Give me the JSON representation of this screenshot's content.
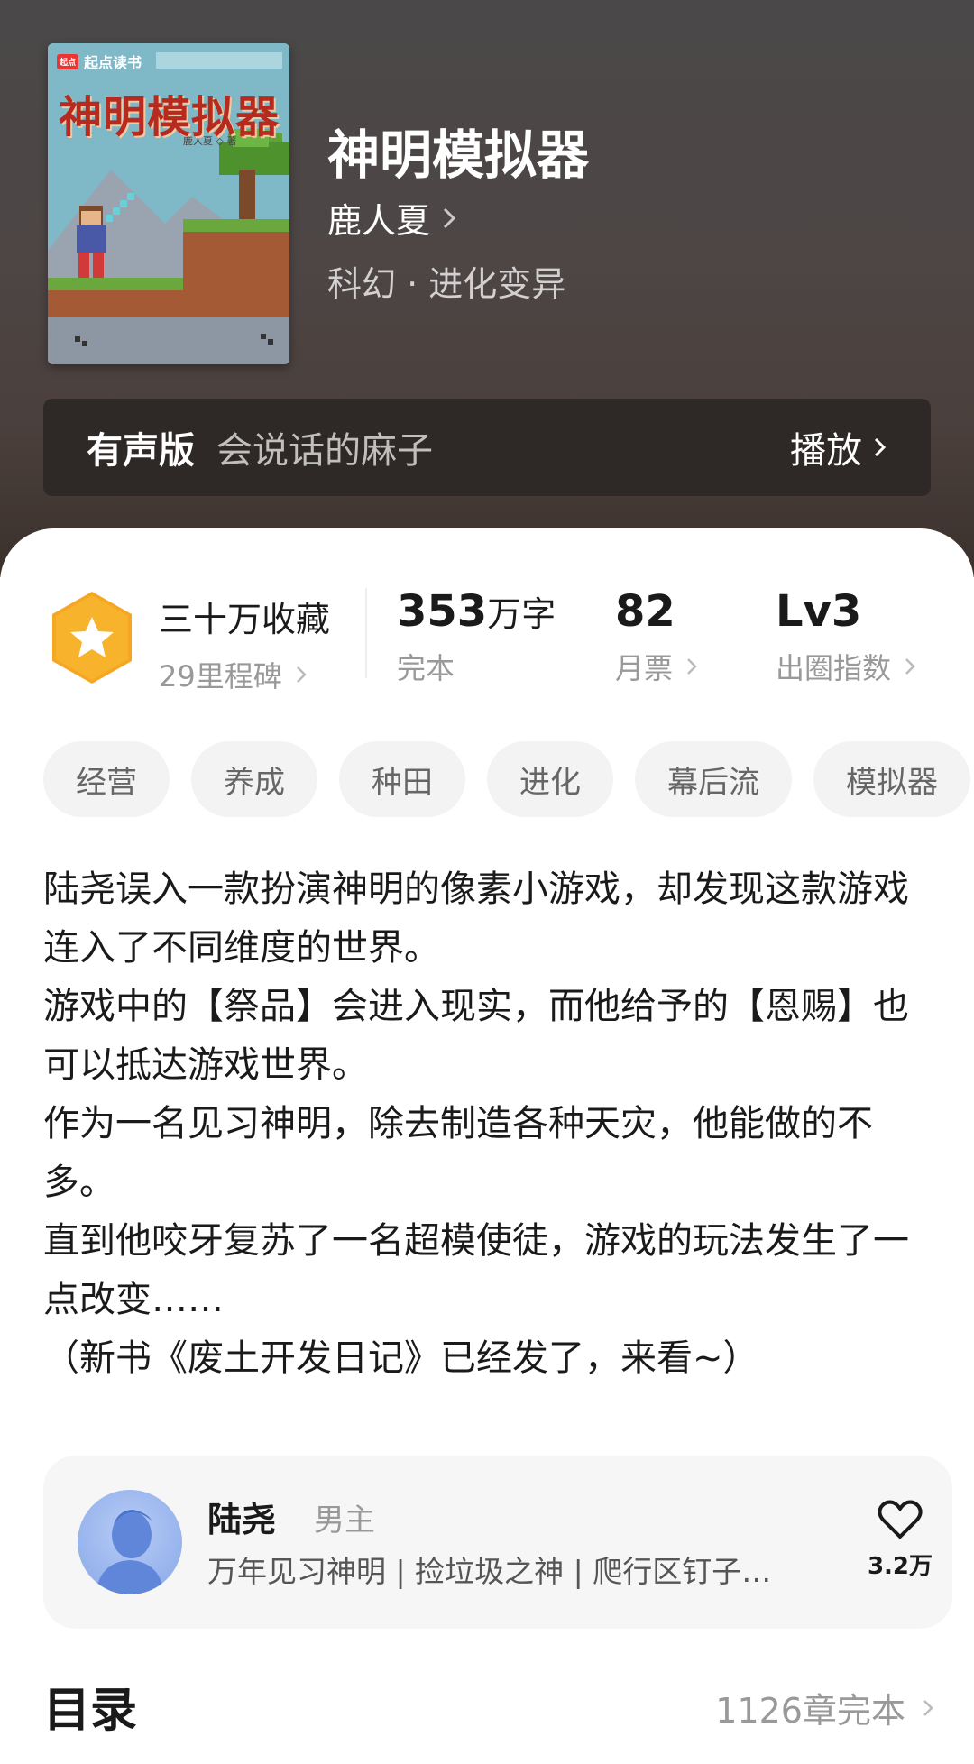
{
  "book": {
    "cover_brand": "起点读书",
    "cover_brand_logo": "起点",
    "cover_title": "神明模拟器",
    "cover_author": "鹿人夏 ◇ 著",
    "title": "神明模拟器",
    "author": "鹿人夏",
    "genre": "科幻 · 进化变异"
  },
  "audio": {
    "label": "有声版",
    "narrator": "会说话的麻子",
    "play_label": "播放"
  },
  "stats": {
    "favorites": "三十万收藏",
    "milestones": "29里程碑",
    "word_count": "353",
    "word_unit": "万字",
    "status": "完本",
    "monthly_tickets": "82",
    "monthly_tickets_label": "月票",
    "level": "Lv3",
    "level_label": "出圈指数"
  },
  "tags": [
    "经营",
    "养成",
    "种田",
    "进化",
    "幕后流",
    "模拟器"
  ],
  "synopsis": [
    "陆尧误入一款扮演神明的像素小游戏，却发现这款游戏连入了不同维度的世界。",
    "游戏中的【祭品】会进入现实，而他给予的【恩赐】也可以抵达游戏世界。",
    "作为一名见习神明，除去制造各种天灾，他能做的不多。",
    "直到他咬牙复苏了一名超模使徒，游戏的玩法发生了一点改变……",
    "（新书《废土开发日记》已经发了，来看~）"
  ],
  "character": {
    "name": "陆尧",
    "role": "男主",
    "description": "万年见习神明 | 捡垃圾之神 | 爬行区钉子…",
    "likes": "3.2万"
  },
  "toc": {
    "title": "目录",
    "info": "1126章完本"
  },
  "colors": {
    "badge": "#f5a623",
    "accent_text": "#1a1a1a",
    "muted_text": "#999999"
  },
  "icons": {
    "badge": "star-badge-icon",
    "chevron": "chevron-right-icon",
    "like": "heart-icon",
    "avatar": "person-silhouette-avatar"
  }
}
